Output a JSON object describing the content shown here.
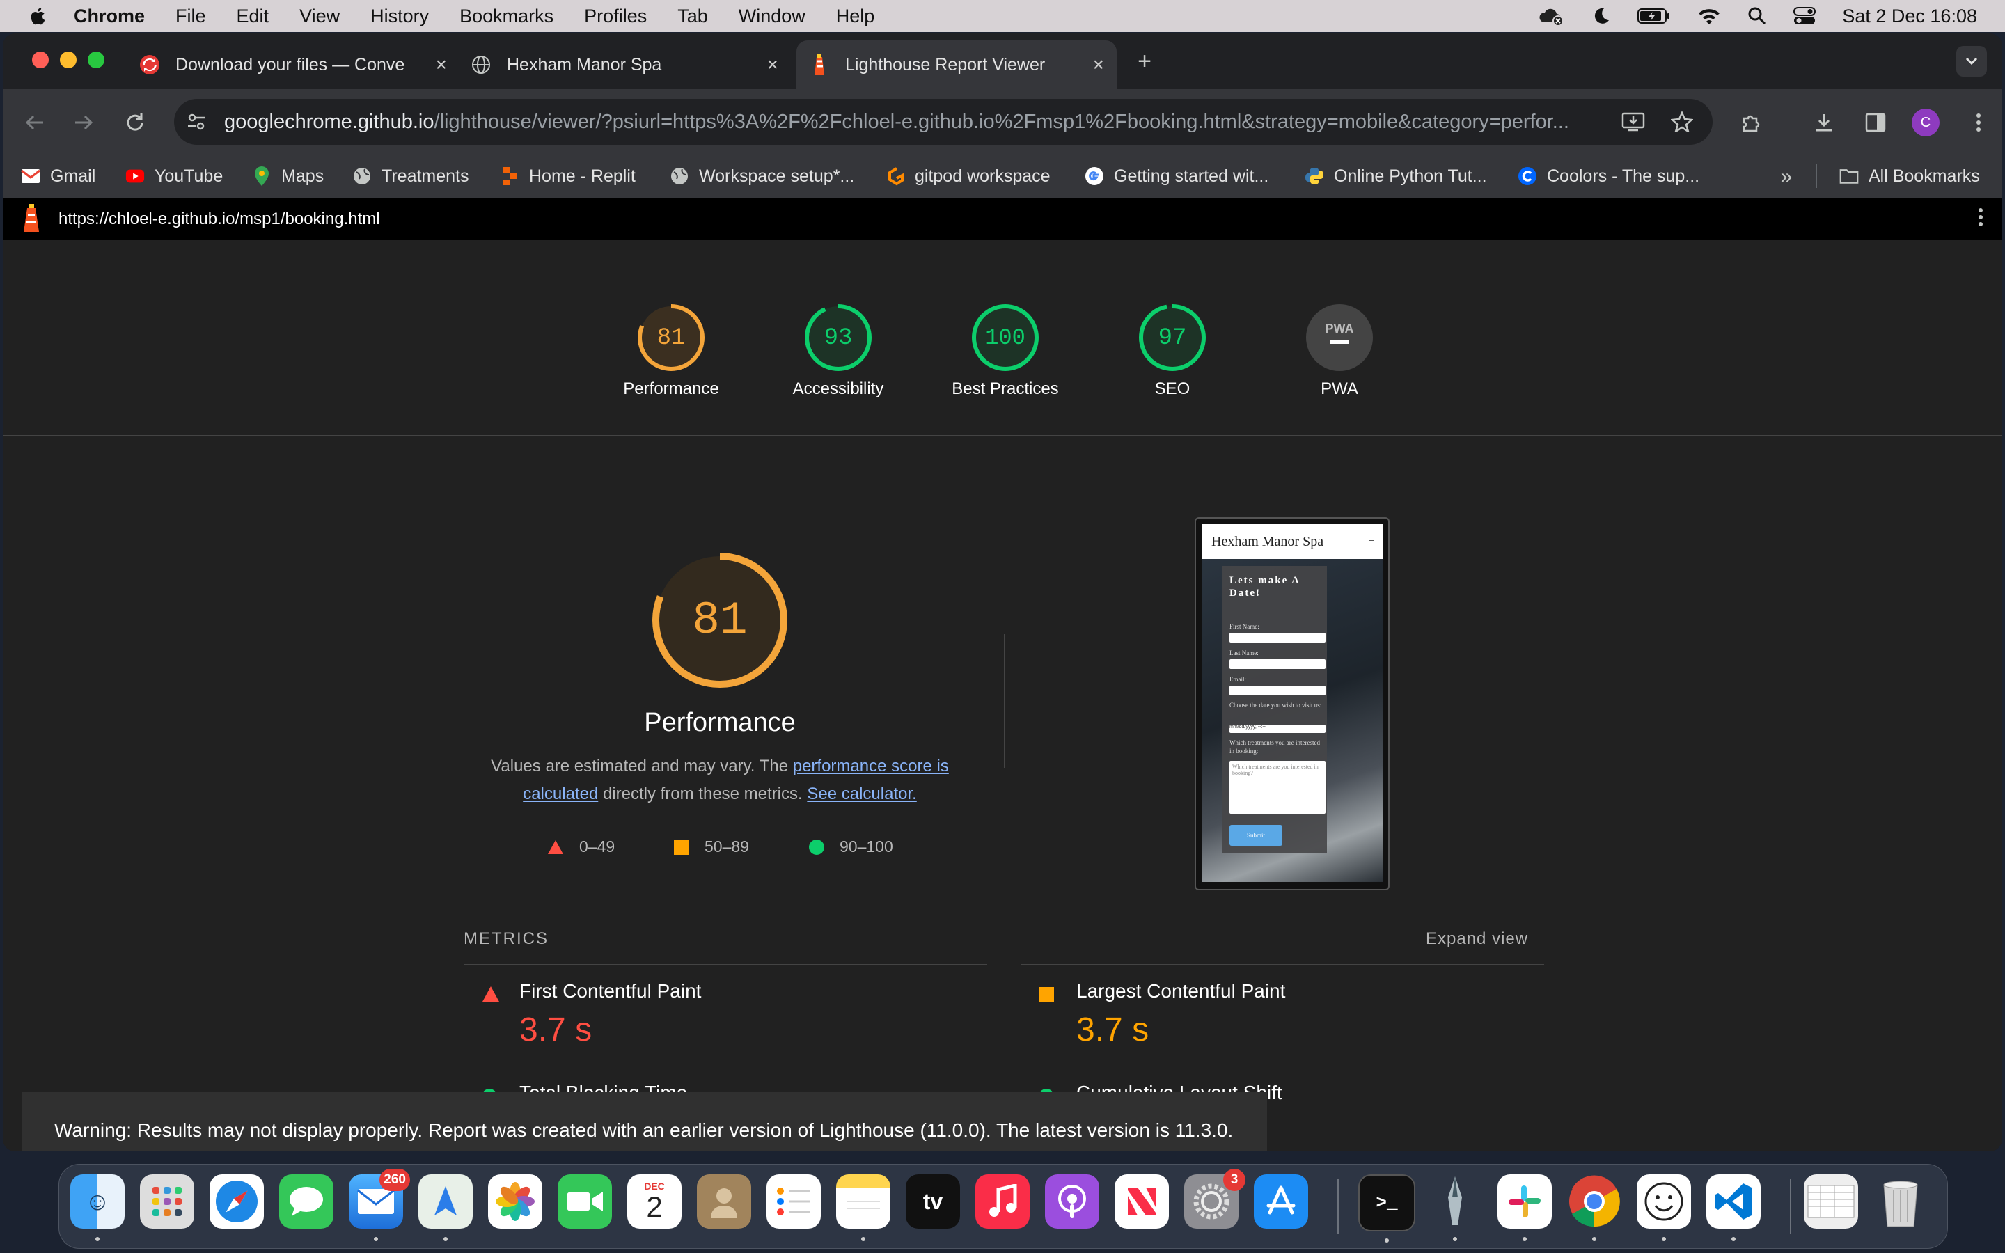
{
  "menubar": {
    "app": "Chrome",
    "items": [
      "File",
      "Edit",
      "View",
      "History",
      "Bookmarks",
      "Profiles",
      "Tab",
      "Window",
      "Help"
    ],
    "clock": "Sat 2 Dec  16:08"
  },
  "tabs": [
    {
      "title": "Download your files — Conve",
      "icon": "convertio-icon"
    },
    {
      "title": "Hexham Manor Spa",
      "icon": "globe-icon"
    },
    {
      "title": "Lighthouse Report Viewer",
      "icon": "lighthouse-icon",
      "active": true
    }
  ],
  "omnibox": {
    "host": "googlechrome.github.io",
    "path": "/lighthouse/viewer/?psiurl=https%3A%2F%2Fchloel-e.github.io%2Fmsp1%2Fbooking.html&strategy=mobile&category=perfor..."
  },
  "profile_initial": "C",
  "bookmarks": [
    {
      "label": "Gmail",
      "icon": "gmail-icon",
      "color": "#ea4335"
    },
    {
      "label": "YouTube",
      "icon": "youtube-icon",
      "color": "#ff0000"
    },
    {
      "label": "Maps",
      "icon": "maps-icon",
      "color": "#34a853"
    },
    {
      "label": "Treatments",
      "icon": "globe-icon",
      "color": "#9aa0a6"
    },
    {
      "label": "Home - Replit",
      "icon": "replit-icon",
      "color": "#f26207"
    },
    {
      "label": "Workspace setup*...",
      "icon": "globe-icon",
      "color": "#9aa0a6"
    },
    {
      "label": "gitpod workspace",
      "icon": "gitpod-icon",
      "color": "#ff8a00"
    },
    {
      "label": "Getting started wit...",
      "icon": "google-icon",
      "color": "#4285f4"
    },
    {
      "label": "Online Python Tut...",
      "icon": "python-icon",
      "color": "#3776ab"
    },
    {
      "label": "Coolors - The sup...",
      "icon": "coolors-icon",
      "color": "#0066ff"
    }
  ],
  "all_bookmarks": "All Bookmarks",
  "report_url": "https://chloel-e.github.io/msp1/booking.html",
  "gauges": [
    {
      "score": "81",
      "label": "Performance",
      "value": 81,
      "color": "#f4a53a"
    },
    {
      "score": "93",
      "label": "Accessibility",
      "value": 93,
      "color": "#0cce6b"
    },
    {
      "score": "100",
      "label": "Best Practices",
      "value": 100,
      "color": "#0cce6b"
    },
    {
      "score": "97",
      "label": "SEO",
      "value": 97,
      "color": "#0cce6b"
    },
    {
      "score": "PWA",
      "label": "PWA",
      "value": null,
      "color": "#9aa0a6"
    }
  ],
  "performance": {
    "score": "81",
    "value": 81,
    "title": "Performance",
    "desc_pre": "Values are estimated and may vary. The ",
    "desc_link": "performance score is calculated",
    "desc_mid": " directly from these metrics. ",
    "desc_link2": "See calculator.",
    "legend": [
      "0–49",
      "50–89",
      "90–100"
    ]
  },
  "screenshot": {
    "site": "Hexham Manor Spa",
    "heading": "Lets make A Date!",
    "fields": [
      "First Name:",
      "Last Name:",
      "Email:",
      "Choose the date you wish to visit us:",
      "Which treatments you are interested in booking:"
    ],
    "date_placeholder": "mm/dd/yyyy, --:--",
    "textarea_placeholder": "Which treatments are you interested in booking?",
    "submit": "Submit"
  },
  "metrics": {
    "header": "METRICS",
    "expand": "Expand view",
    "items": [
      {
        "name": "First Contentful Paint",
        "value": "3.7 s",
        "status": "fail",
        "color": "#ff4e42"
      },
      {
        "name": "Largest Contentful Paint",
        "value": "3.7 s",
        "status": "average",
        "color": "#ffa400"
      },
      {
        "name": "Total Blocking Time",
        "status": "pass"
      },
      {
        "name": "Cumulative Layout Shift",
        "status": "pass"
      }
    ]
  },
  "warning": "Warning: Results may not display properly. Report was created with an earlier version of Lighthouse (11.0.0). The latest version is 11.3.0.",
  "dock": {
    "mail_badge": "260",
    "settings_badge": "3",
    "calendar_month": "DEC",
    "calendar_day": "2",
    "tv_label": "tv"
  }
}
